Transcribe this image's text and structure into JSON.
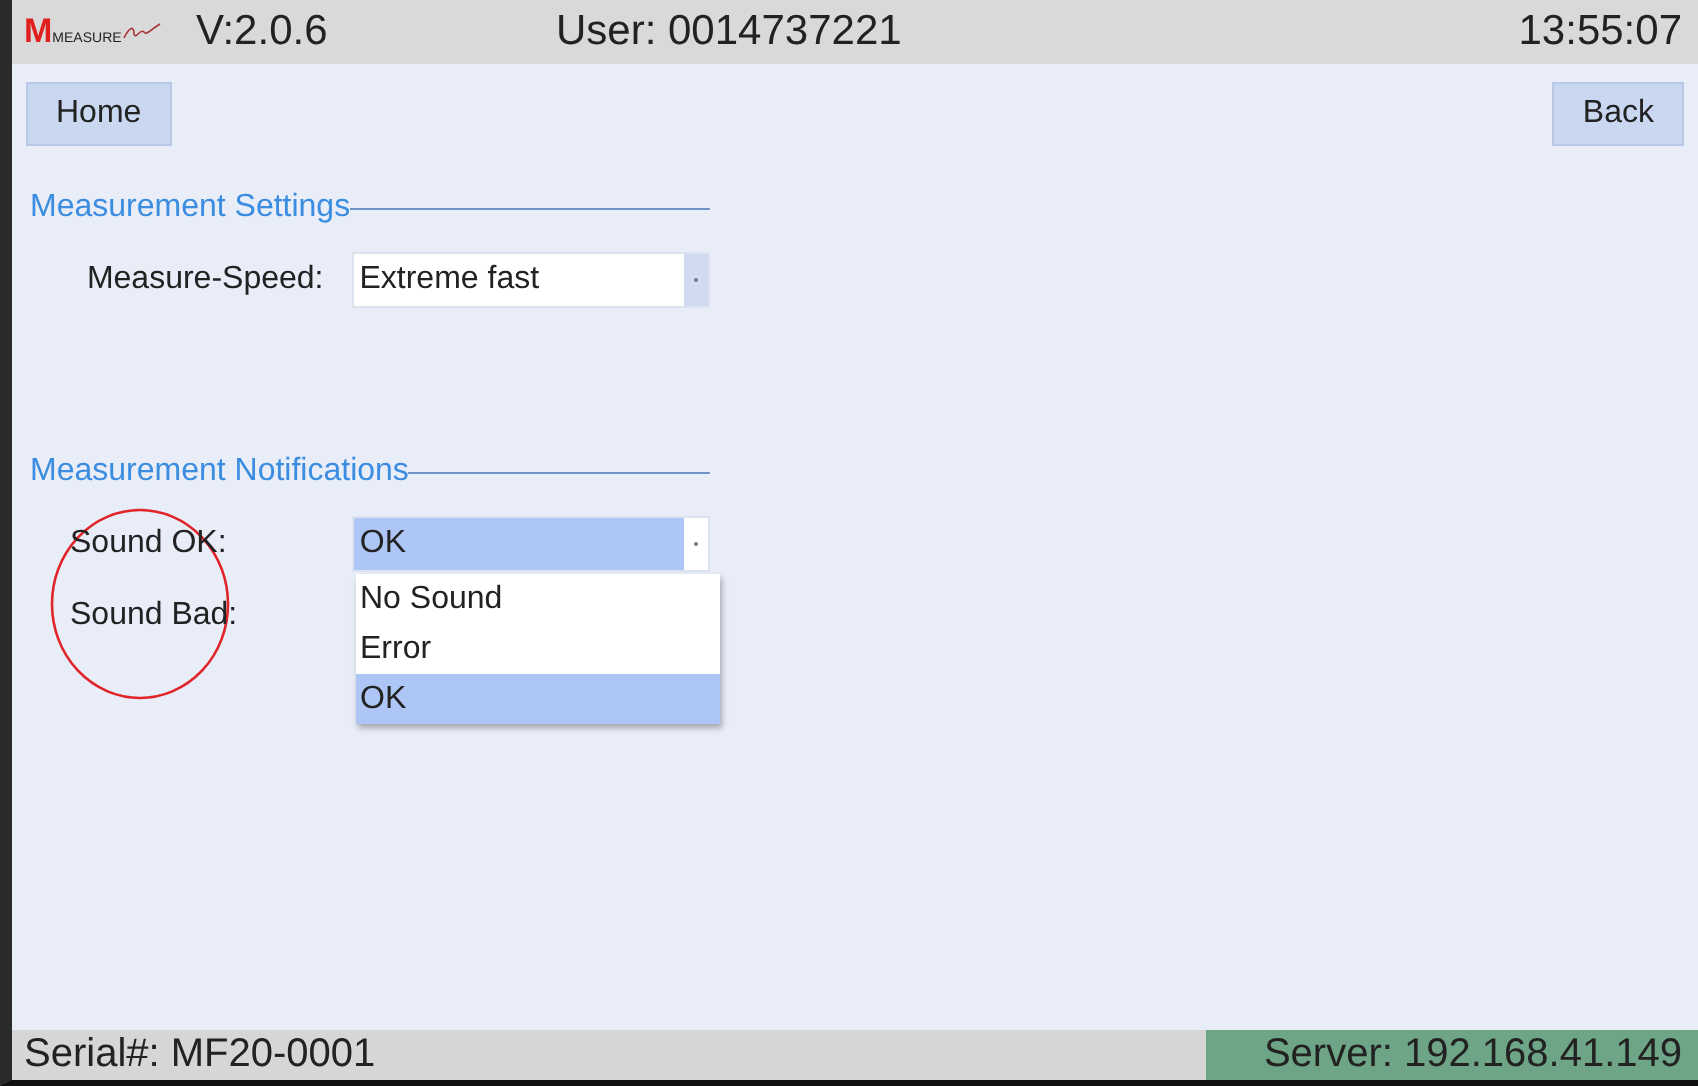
{
  "header": {
    "logo_letter": "M",
    "logo_word": "MEASURE",
    "version": "V:2.0.6",
    "user": "User: 0014737221",
    "time": "13:55:07"
  },
  "nav": {
    "home": "Home",
    "back": "Back"
  },
  "sections": [
    {
      "title": "Measurement Settings",
      "fields": [
        {
          "label": "Measure-Speed:",
          "value": "Extreme fast"
        }
      ]
    },
    {
      "title": "Measurement Notifications",
      "circled": true,
      "fields": [
        {
          "label": "Sound OK:",
          "value": "OK",
          "open": true,
          "options": [
            {
              "label": "No Sound",
              "selected": false
            },
            {
              "label": "Error",
              "selected": false
            },
            {
              "label": "OK",
              "selected": true
            }
          ]
        },
        {
          "label": "Sound Bad:"
        }
      ]
    }
  ],
  "status_bar": {
    "serial": "Serial#: MF20-0001",
    "server": "Server: 192.168.41.149"
  }
}
